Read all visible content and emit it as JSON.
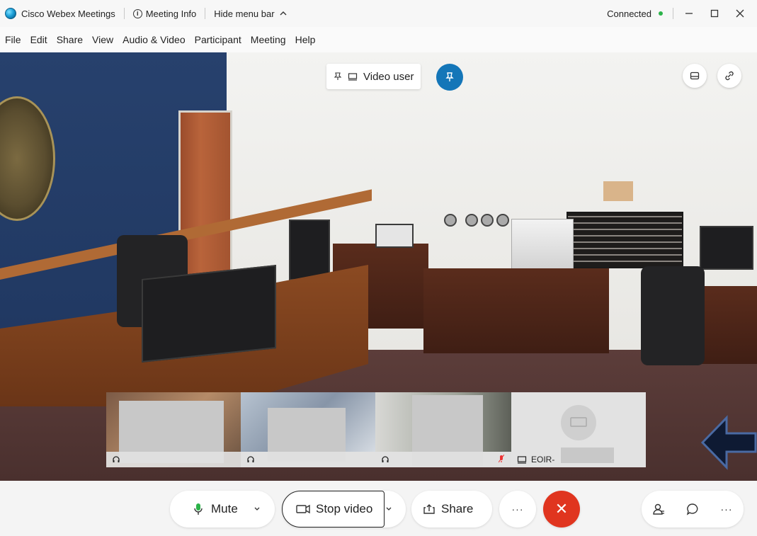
{
  "window": {
    "app_title": "Cisco Webex Meetings",
    "meeting_info_label": "Meeting Info",
    "hide_menu_label": "Hide menu bar",
    "status_text": "Connected",
    "status_color": "#2cb34a"
  },
  "menu": {
    "items": [
      "File",
      "Edit",
      "Share",
      "View",
      "Audio & Video",
      "Participant",
      "Meeting",
      "Help"
    ]
  },
  "stage": {
    "active_user_label": "Video user",
    "pin_color": "#1476b8"
  },
  "filmstrip": {
    "tiles": [
      {
        "label": "",
        "icon": "headset-icon",
        "active": true
      },
      {
        "label": "",
        "icon": "headset-icon",
        "active": false
      },
      {
        "label": "",
        "icon": "headset-icon",
        "muted": true,
        "active": false
      },
      {
        "label": "EOIR-",
        "icon": "device-icon",
        "active": false
      }
    ]
  },
  "controls": {
    "mute_label": "Mute",
    "stop_video_label": "Stop video",
    "share_label": "Share",
    "more_label": "···",
    "end_label": "✕",
    "end_color": "#e0351f",
    "accent_color": "#22a7df"
  }
}
